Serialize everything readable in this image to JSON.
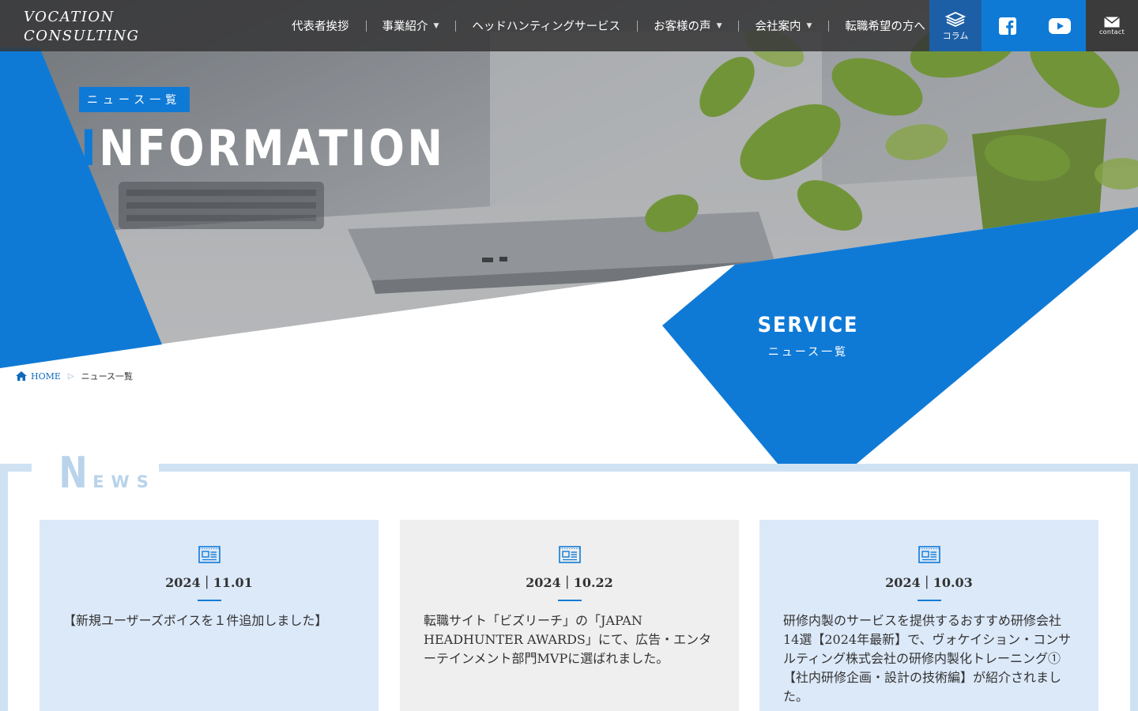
{
  "header": {
    "logo_line1": "VOCATION",
    "logo_line2": "CONSULTING",
    "nav": [
      {
        "label": "代表者挨拶",
        "has_dropdown": false
      },
      {
        "label": "事業紹介",
        "has_dropdown": true
      },
      {
        "label": "ヘッドハンティングサービス",
        "has_dropdown": false
      },
      {
        "label": "お客様の声",
        "has_dropdown": true
      },
      {
        "label": "会社案内",
        "has_dropdown": true
      },
      {
        "label": "転職希望の方へ",
        "has_dropdown": false
      }
    ],
    "column_label": "コラム",
    "contact_label": "contact",
    "caret": "▼"
  },
  "hero": {
    "tag": "ニュース一覧",
    "title_first": "I",
    "title_rest": "NFORMATION",
    "service_title": "SERVICE",
    "service_sub": "ニュース一覧"
  },
  "breadcrumb": {
    "home": "HOME",
    "current": "ニュース一覧"
  },
  "news": {
    "heading_big": "N",
    "heading_rest": "EWS",
    "items": [
      {
        "date": "2024｜11.01",
        "text": "【新規ユーザーズボイスを１件追加しました】",
        "style": "blue"
      },
      {
        "date": "2024｜10.22",
        "text": "転職サイト「ビズリーチ」の「JAPAN HEADHUNTER AWARDS」にて、広告・エンターテインメント部門MVPに選ばれました。",
        "style": "grey"
      },
      {
        "date": "2024｜10.03",
        "text": "研修内製のサービスを提供するおすすめ研修会社14選【2024年最新】で、ヴォケイション・コンサルティング株式会社の研修内製化トレーニング①【社内研修企画・設計の技術編】が紹介されました。",
        "style": "blue"
      }
    ]
  },
  "colors": {
    "brand_blue": "#0f7ad6",
    "header_bg": "#373737",
    "card_blue": "#dce9f9",
    "card_grey": "#efefef",
    "frame_blue": "#cfe2f3"
  }
}
